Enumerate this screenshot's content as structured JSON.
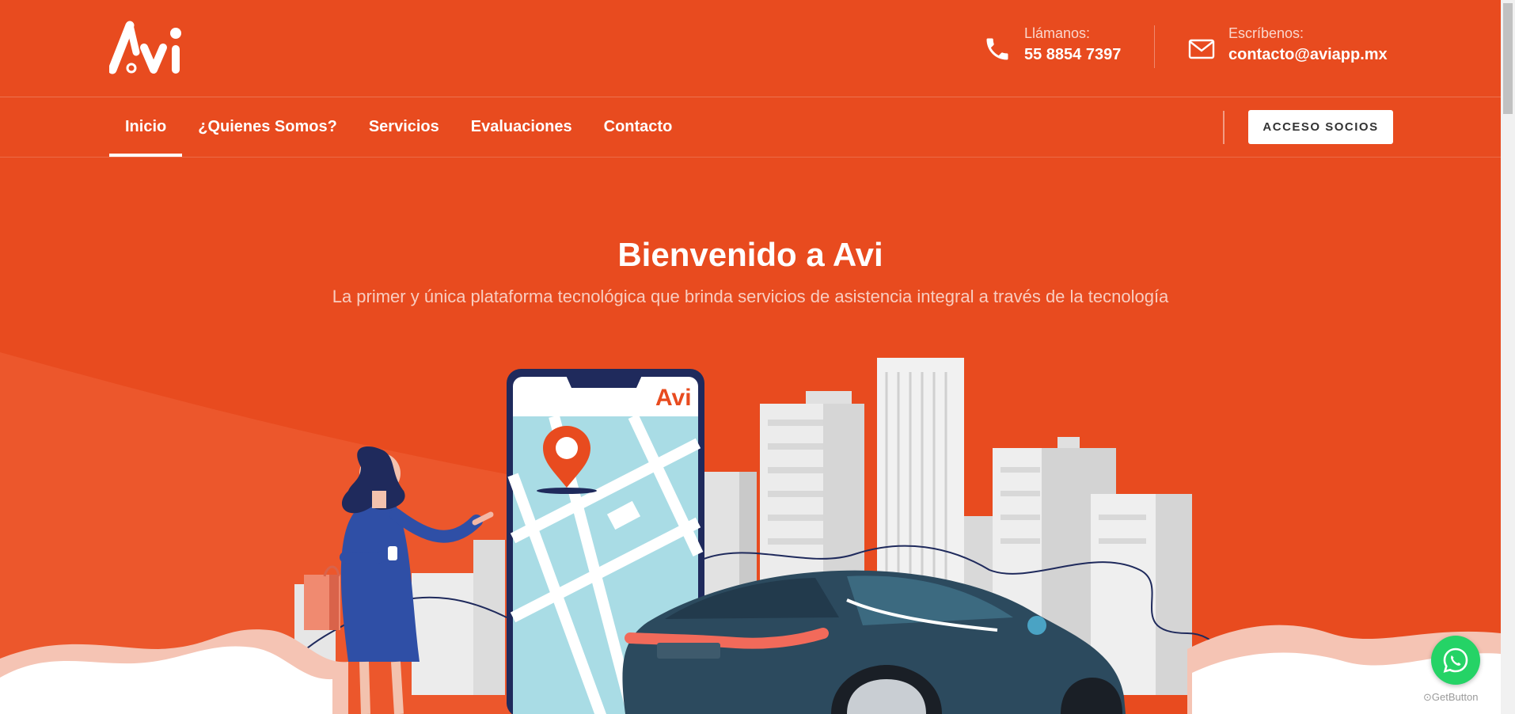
{
  "brand": {
    "logo_text": "Avi",
    "accent": "#e84b1f"
  },
  "header": {
    "phone": {
      "label": "Llámanos:",
      "value": "55 8854 7397",
      "icon": "phone-icon"
    },
    "email": {
      "label": "Escríbenos:",
      "value": "contacto@aviapp.mx",
      "icon": "mail-icon"
    }
  },
  "nav": {
    "items": [
      {
        "label": "Inicio",
        "active": true
      },
      {
        "label": "¿Quienes Somos?",
        "active": false
      },
      {
        "label": "Servicios",
        "active": false
      },
      {
        "label": "Evaluaciones",
        "active": false
      },
      {
        "label": "Contacto",
        "active": false
      }
    ],
    "cta_label": "ACCESO SOCIOS"
  },
  "hero": {
    "title": "Bienvenido a Avi",
    "subtitle": "La primer y única plataforma tecnológica que brinda servicios de asistencia integral a través de la tecnología",
    "phone_logo": "Avi"
  },
  "widgets": {
    "whatsapp_icon": "whatsapp-icon",
    "getbutton_label": "GetButton"
  }
}
